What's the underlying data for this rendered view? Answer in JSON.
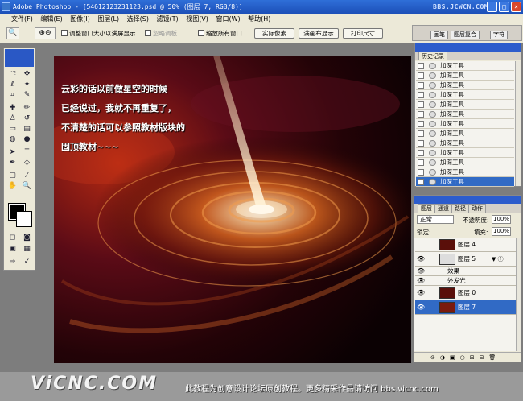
{
  "window": {
    "title": "Adobe Photoshop - [54612123231123.psd @ 50% (图层 7, RGB/8)]",
    "watermark": "BBS.JCWCN.COM",
    "min": "_",
    "max": "□",
    "close": "×"
  },
  "menu": [
    "文件(F)",
    "编辑(E)",
    "图像(I)",
    "图层(L)",
    "选择(S)",
    "滤镜(T)",
    "视图(V)",
    "窗口(W)",
    "帮助(H)"
  ],
  "options": {
    "resize_window": "调整窗口大小以满屏显示",
    "ignore_palettes": "忽略调板",
    "zoom_all": "缩放所有窗口",
    "actual_pixels": "实际像素",
    "fit_screen": "满画布显示",
    "print_size": "打印尺寸"
  },
  "palette_well": [
    "画笔",
    "图层复合",
    "字符"
  ],
  "canvas": {
    "caption_lines": [
      "云彩的话以前做星空的时候",
      "已经说过，我就不再重复了，",
      "不清楚的话可以参照教材版块的",
      "固顶教材~~~"
    ]
  },
  "history": {
    "tab": "历史记录",
    "items": [
      "加深工具",
      "加深工具",
      "加深工具",
      "加深工具",
      "加深工具",
      "加深工具",
      "加深工具",
      "加深工具",
      "加深工具",
      "加深工具",
      "加深工具",
      "加深工具",
      "加深工具"
    ],
    "selected_index": 12
  },
  "layers": {
    "tabs": [
      "图层",
      "通道",
      "路径",
      "动作"
    ],
    "blend_mode": "正常",
    "opacity_label": "不透明度:",
    "opacity": "100%",
    "lock_label": "锁定:",
    "fill_label": "填充:",
    "fill": "100%",
    "rows": [
      "图层 4",
      "图层 5",
      "效果",
      "外发光",
      "图层 0",
      "图层 7"
    ],
    "selected": "图层 7"
  },
  "footer": {
    "brand": "ViCNC.COM",
    "text": "此教程为创意设计论坛原创教程。更多精采作品请访问 bbs.vicnc.com"
  }
}
